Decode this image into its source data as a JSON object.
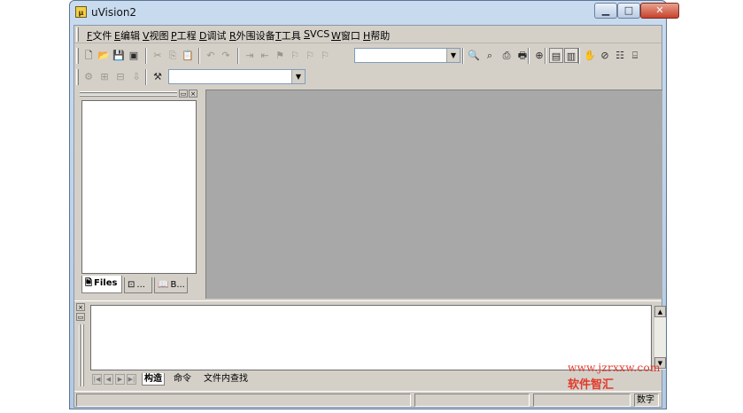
{
  "window": {
    "title": "uVision2",
    "app_icon": "uvision-icon"
  },
  "caption_buttons": {
    "minimize": "▁",
    "maximize": "□",
    "close": "✕"
  },
  "menu": {
    "items": [
      {
        "accel": "F",
        "label": "文件"
      },
      {
        "accel": "E",
        "label": "编辑"
      },
      {
        "accel": "V",
        "label": "视图"
      },
      {
        "accel": "P",
        "label": "工程"
      },
      {
        "accel": "D",
        "label": "调试"
      },
      {
        "accel": "R",
        "label": "外围设备"
      },
      {
        "accel": "T",
        "label": "工具"
      },
      {
        "accel": "S",
        "label": "VCS"
      },
      {
        "accel": "W",
        "label": "窗口"
      },
      {
        "accel": "H",
        "label": "帮助"
      }
    ]
  },
  "toolbar1": {
    "buttons": [
      {
        "icon": "new-file-icon",
        "glyph": "🗋"
      },
      {
        "icon": "open-folder-icon",
        "glyph": "📂"
      },
      {
        "icon": "save-icon",
        "glyph": "💾"
      },
      {
        "icon": "save-all-icon",
        "glyph": "▣"
      },
      {
        "icon": "cut-icon",
        "glyph": "✂"
      },
      {
        "icon": "copy-icon",
        "glyph": "⎘"
      },
      {
        "icon": "paste-icon",
        "glyph": "📋"
      },
      {
        "icon": "undo-icon",
        "glyph": "↶"
      },
      {
        "icon": "redo-icon",
        "glyph": "↷"
      },
      {
        "icon": "indent-icon",
        "glyph": "⇥"
      },
      {
        "icon": "unindent-icon",
        "glyph": "⇤"
      },
      {
        "icon": "bookmark-toggle-icon",
        "glyph": "⚑"
      },
      {
        "icon": "bookmark-next-icon",
        "glyph": "⚐"
      },
      {
        "icon": "bookmark-prev-icon",
        "glyph": "⚐"
      },
      {
        "icon": "bookmark-clear-icon",
        "glyph": "⚐"
      },
      {
        "icon": "find-in-files-icon",
        "glyph": "🔍"
      },
      {
        "icon": "find-icon",
        "glyph": "⌕"
      },
      {
        "icon": "incremental-find-icon",
        "glyph": "⎙"
      },
      {
        "icon": "print-icon",
        "glyph": "🖶"
      },
      {
        "icon": "zoom-icon",
        "glyph": "⊕"
      },
      {
        "icon": "workspace-window-icon",
        "glyph": "▤"
      },
      {
        "icon": "output-window-icon",
        "glyph": "▥"
      },
      {
        "icon": "hand-icon",
        "glyph": "✋"
      },
      {
        "icon": "stop-icon",
        "glyph": "⊘"
      },
      {
        "icon": "config-icon",
        "glyph": "☷"
      },
      {
        "icon": "help-book-icon",
        "glyph": "⌸"
      }
    ],
    "find_combo_value": ""
  },
  "toolbar2": {
    "buttons": [
      {
        "icon": "translate-icon",
        "glyph": "⚙"
      },
      {
        "icon": "build-target-icon",
        "glyph": "⊞"
      },
      {
        "icon": "rebuild-all-icon",
        "glyph": "⊟"
      },
      {
        "icon": "download-icon",
        "glyph": "⇩"
      },
      {
        "icon": "target-options-icon",
        "glyph": "⚒"
      }
    ],
    "target_combo_value": ""
  },
  "project_panel": {
    "tabs": [
      {
        "icon": "files-tab-icon",
        "glyph": "🗎",
        "label": "Files"
      },
      {
        "icon": "regs-tab-icon",
        "glyph": "⊡",
        "label": "..."
      },
      {
        "icon": "books-tab-icon",
        "glyph": "📖",
        "label": "B..."
      }
    ]
  },
  "output_panel": {
    "tabs": [
      {
        "label": "构造"
      },
      {
        "label": "命令"
      },
      {
        "label": "文件内查找"
      }
    ]
  },
  "status_bar": {
    "num_indicator": "数字"
  },
  "watermark": {
    "url": "www.jzrxxw.com",
    "name": "软件智汇"
  }
}
